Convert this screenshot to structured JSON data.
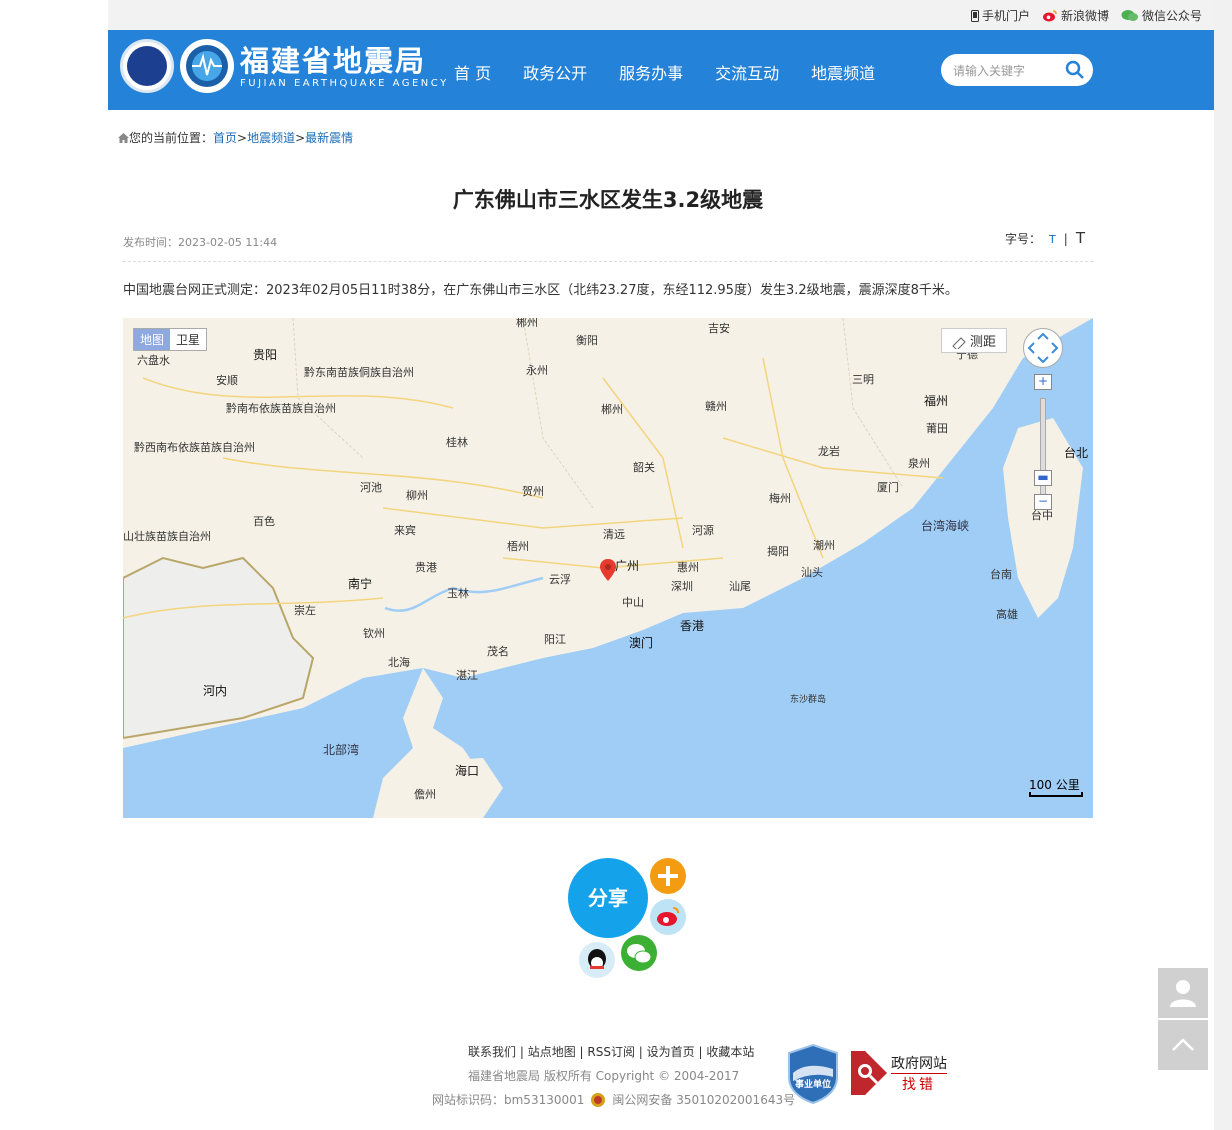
{
  "toplinks": {
    "mobile": "手机门户",
    "weibo": "新浪微博",
    "wechat": "微信公众号"
  },
  "header": {
    "logo_cn": "福建省地震局",
    "logo_en": "FUJIAN EARTHQUAKE AGENCY",
    "nav": [
      "首 页",
      "政务公开",
      "服务办事",
      "交流互动",
      "地震频道"
    ],
    "search_placeholder": "请输入关键字"
  },
  "breadcrumb": {
    "prefix": "您的当前位置：",
    "items": [
      "首页",
      "地震频道",
      "最新震情"
    ],
    "separator": ">"
  },
  "article": {
    "title": "广东佛山市三水区发生3.2级地震",
    "publish_time": "发布时间：2023-02-05 11:44",
    "font_label": "字号：",
    "font_small": "T",
    "font_sep": "|",
    "font_large": "T",
    "body": "中国地震台网正式测定：2023年02月05日11时38分，在广东佛山市三水区（北纬23.27度，东经112.95度）发生3.2级地震，震源深度8千米。"
  },
  "map": {
    "type_map": "地图",
    "type_satellite": "卫星",
    "measure": "测距",
    "scale": "100 公里",
    "zoom_in": "+",
    "zoom_out": "−",
    "labels": {
      "chenzhou_top": "郴州",
      "hengyang": "衡阳",
      "jian": "吉安",
      "liupanshui": "六盘水",
      "guiyang": "贵阳",
      "qiandongnan": "黔东南苗族侗族自治州",
      "yongzhou": "永州",
      "sanming": "三明",
      "ningde": "宁德",
      "anshun": "安顺",
      "qiannan": "黔南布依族苗族自治州",
      "chenzhou": "郴州",
      "ganzhou": "赣州",
      "fuzhou": "福州",
      "qianxinan": "黔西南布依族苗族自治州",
      "guilin": "桂林",
      "putian": "莆田",
      "taibei": "台北",
      "shaoguan": "韶关",
      "longyan": "龙岩",
      "quanzhou": "泉州",
      "hechi": "河池",
      "liuzhou": "柳州",
      "hezhou": "贺州",
      "meizhou": "梅州",
      "xiamen": "厦门",
      "baise": "百色",
      "laibin": "来宾",
      "qingyuan": "清远",
      "heyuan": "河源",
      "taiwan_strait": "台湾海峡",
      "zhuang": "山壮族苗族自治州",
      "wuzhou": "梧州",
      "jieyang": "揭阳",
      "chaozhou": "潮州",
      "guangzhou": "广州",
      "huizhou": "惠州",
      "taizhong": "台中",
      "guigang": "贵港",
      "yunfu": "云浮",
      "shantou": "汕头",
      "nanning": "南宁",
      "shenzhen": "深圳",
      "tainan": "台南",
      "yulin": "玉林",
      "shanwei": "汕尾",
      "chongzuo": "崇左",
      "zhongshan": "中山",
      "hongkong": "香港",
      "gaoxiong": "高雄",
      "qinzhou": "钦州",
      "yangjiang": "阳江",
      "macau": "澳门",
      "maoming": "茂名",
      "beihai": "北海",
      "hanoi": "河内",
      "zhanjiang": "湛江",
      "dongsha": "东沙群岛",
      "beibu": "北部湾",
      "haikou": "海口",
      "danzhou": "儋州"
    }
  },
  "share": {
    "label": "分享"
  },
  "footer": {
    "links": [
      "联系我们",
      "站点地图",
      "RSS订阅",
      "设为首页",
      "收藏本站"
    ],
    "link_sep": " | ",
    "copyright": "福建省地震局   版权所有    Copyright © 2004-2017",
    "site_id": "网站标识码：bm53130001",
    "icp": "闽公网安备 35010202001643号",
    "badge1": "事业单位",
    "badge2_line1": "政府网站",
    "badge2_line2": "找错"
  },
  "colors": {
    "header_blue": "#2482d8",
    "share_blue": "#14a3ea",
    "link_blue": "#1b6bb5",
    "sea_blue": "#9fcdf5",
    "land": "#f5f1e6"
  }
}
